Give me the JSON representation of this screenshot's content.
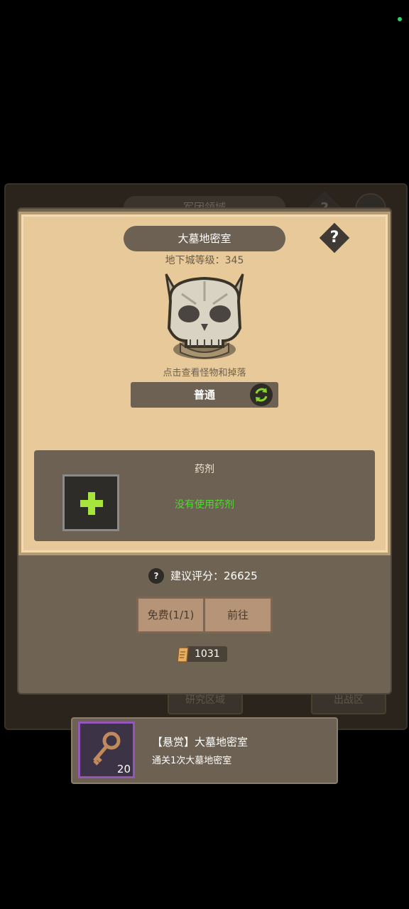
{
  "background_window": {
    "title": "军团领域",
    "help_symbol": "?",
    "button_left": "研究区域",
    "button_right": "出战区"
  },
  "dungeon": {
    "name": "大墓地密室",
    "level_text": "地下城等级：345",
    "help_symbol": "?",
    "monster_icon": "horned-skull-icon",
    "hint": "点击查看怪物和掉落",
    "difficulty": "普通"
  },
  "potion": {
    "title": "药剂",
    "status": "没有使用药剂",
    "status_color": "#4fda2f"
  },
  "recommend": {
    "help_symbol": "?",
    "label": "建议评分：26625"
  },
  "buttons": {
    "free": "免费(1/1)",
    "go": "前往"
  },
  "currency": {
    "icon": "scroll-icon",
    "amount": "1031"
  },
  "quest": {
    "icon": "key-icon",
    "count": "20",
    "title": "【悬赏】大墓地密室",
    "description": "通关1次大墓地密室",
    "border_color": "#9257b8"
  }
}
